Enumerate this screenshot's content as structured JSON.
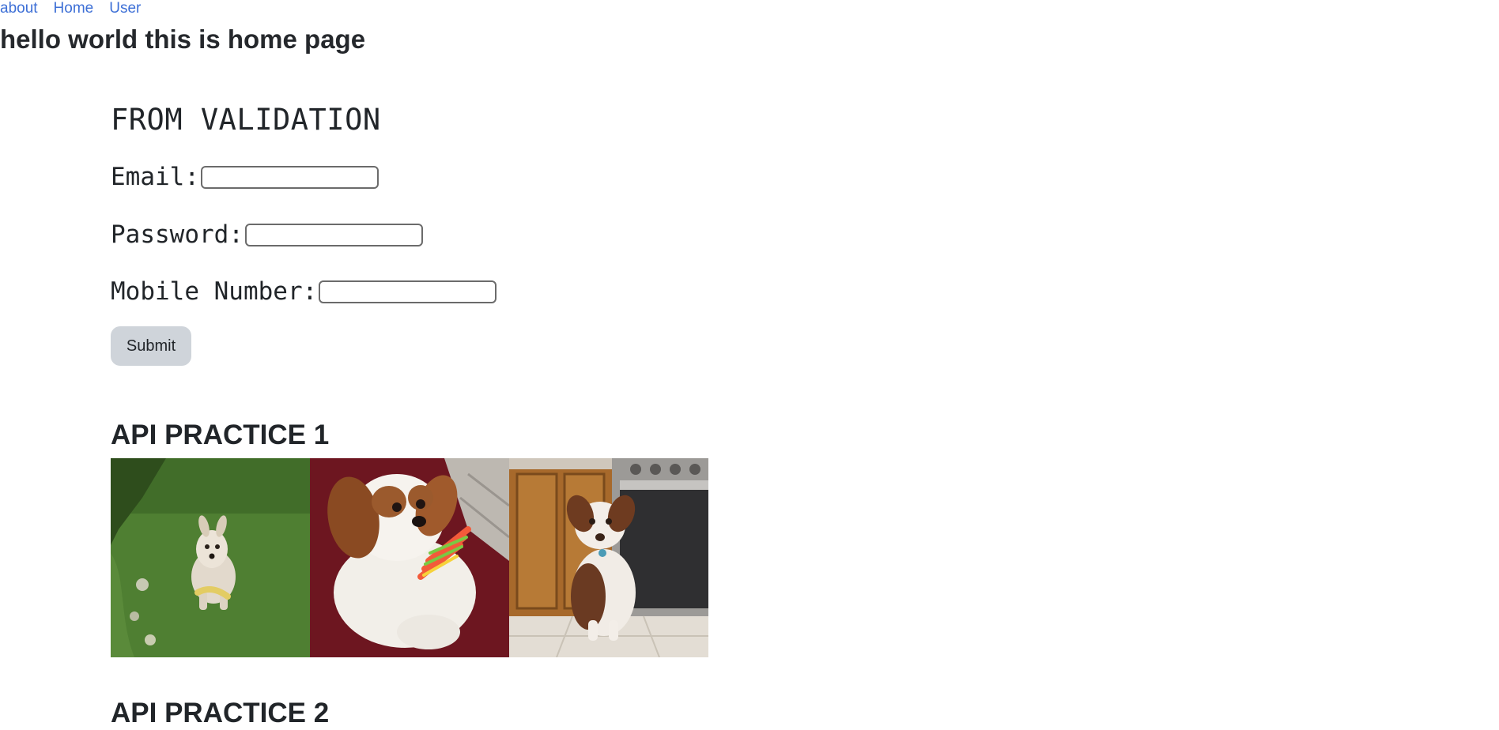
{
  "nav": {
    "items": [
      "about",
      "Home",
      "User"
    ]
  },
  "page": {
    "title": "hello world this is home page"
  },
  "form": {
    "heading": "FROM VALIDATION",
    "email_label": "Email:",
    "email_value": "",
    "password_label": "Password:",
    "password_value": "",
    "mobile_label": "Mobile Number:",
    "mobile_value": "",
    "submit_label": "Submit"
  },
  "api_practice_1": {
    "heading": "API PRACTICE 1",
    "images": [
      "dog-photo-terrier-on-grass",
      "dog-photo-cavalier-spaniel-with-toy",
      "dog-photo-australian-shepherd-in-kitchen"
    ]
  },
  "api_practice_2": {
    "heading": "API PRACTICE 2"
  },
  "colors": {
    "link": "#3d6fd6",
    "button_bg": "#cfd4da",
    "text": "#212529"
  }
}
